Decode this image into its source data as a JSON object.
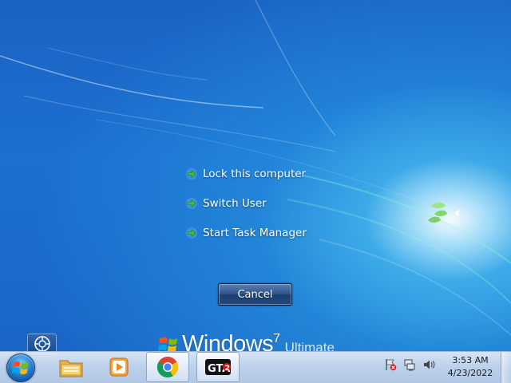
{
  "security_menu": {
    "items": [
      {
        "label": "Lock this computer",
        "icon": "green-arrow-icon"
      },
      {
        "label": "Switch User",
        "icon": "green-arrow-icon"
      },
      {
        "label": "Start Task Manager",
        "icon": "green-arrow-icon"
      }
    ],
    "cancel_label": "Cancel"
  },
  "branding": {
    "wordmark": "Windows",
    "version": "7",
    "edition": "Ultimate"
  },
  "ease_of_access": {
    "icon": "ease-of-access-icon"
  },
  "taskbar": {
    "start": {
      "icon": "windows-start-orb-icon"
    },
    "pinned": [
      {
        "name": "file-explorer",
        "icon": "folder-icon"
      },
      {
        "name": "media-player",
        "icon": "media-player-icon"
      },
      {
        "name": "chrome",
        "icon": "chrome-icon",
        "active": true
      },
      {
        "name": "gta2",
        "icon": "gta2-icon",
        "active": true
      }
    ],
    "tray": [
      {
        "name": "action-center",
        "icon": "flag-error-icon"
      },
      {
        "name": "network",
        "icon": "network-icon"
      },
      {
        "name": "volume",
        "icon": "speaker-icon"
      }
    ],
    "clock": {
      "time": "3:53 AM",
      "date": "4/23/2022"
    }
  },
  "colors": {
    "desktop_blue": "#1b63c3",
    "cancel_button": "#2f548a",
    "arrow_green": "#3fbf3f",
    "taskbar": "#d5e2f2"
  }
}
